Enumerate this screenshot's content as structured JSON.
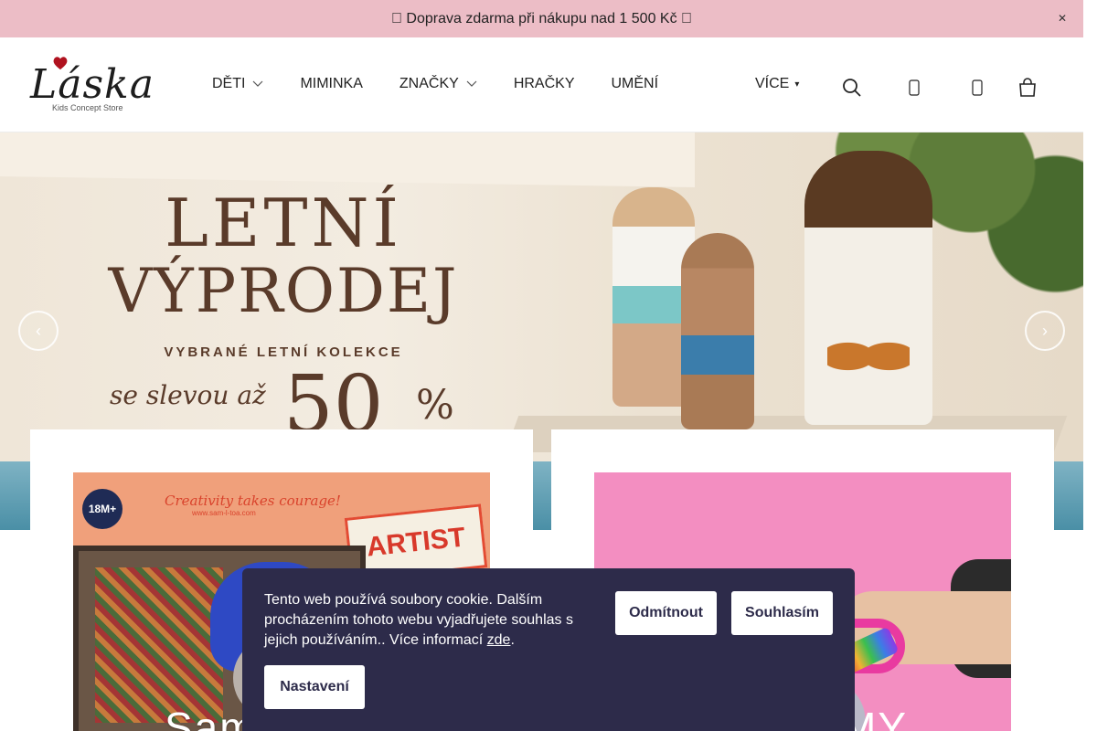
{
  "promo": {
    "text": " Doprava zdarma při nákupu nad 1 500 Kč ",
    "close_icon": "close-icon"
  },
  "header": {
    "logo_text": "Láska",
    "logo_sub": "Kids Concept Store",
    "nav": [
      {
        "label": "DĚTI",
        "has_dropdown": true
      },
      {
        "label": "MIMINKA",
        "has_dropdown": false
      },
      {
        "label": "ZNAČKY",
        "has_dropdown": true
      },
      {
        "label": "HRAČKY",
        "has_dropdown": false
      },
      {
        "label": "UMĚNÍ",
        "has_dropdown": false
      }
    ],
    "more_label": "VÍCE",
    "icons": [
      "search-icon",
      "user-icon",
      "heart-icon",
      "cart-icon"
    ]
  },
  "hero": {
    "line1": "LETNÍ",
    "line2": "VÝPRODEJ",
    "line3": "VYBRANÉ LETNÍ KOLEKCE",
    "script": "se slevou až",
    "big": "50",
    "pct": "%",
    "prev_icon": "chevron-left-icon",
    "next_icon": "chevron-right-icon"
  },
  "cards": [
    {
      "badge": "18M+",
      "slogan": "Creativity takes courage!",
      "slogan2": "www.sam-l-toa.com",
      "artist": "ARTIST",
      "label": "Sam"
    },
    {
      "label": "MY"
    }
  ],
  "cookie": {
    "text": "Tento web používá soubory cookie. Dalším procházením tohoto webu vyjadřujete souhlas s jejich používáním.. Více informací ",
    "link": "zde",
    "after_link": ".",
    "decline": "Odmítnout",
    "accept": "Souhlasím",
    "settings": "Nastavení"
  },
  "colors": {
    "promo_bg": "#ecbdc6",
    "cookie_bg": "#2d2b4a",
    "hero_text": "#5a3b2a"
  }
}
